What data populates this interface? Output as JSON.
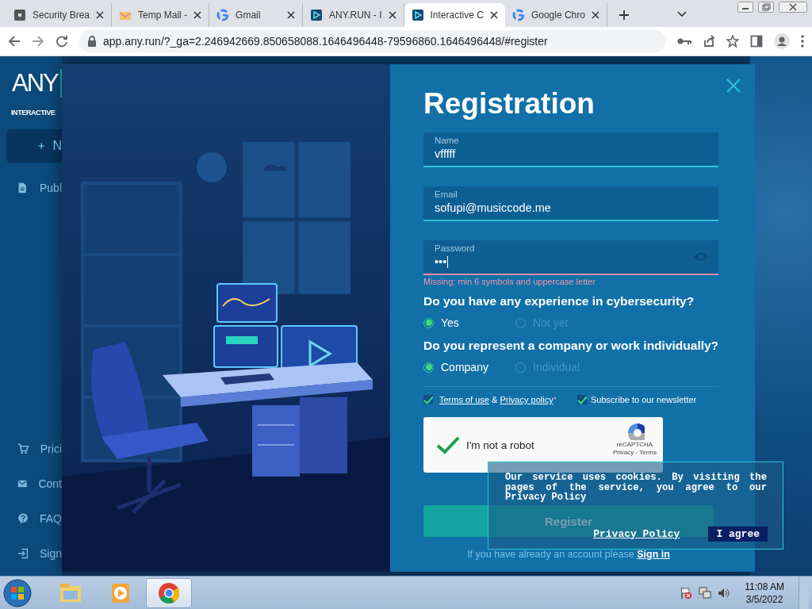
{
  "browser": {
    "tabs": [
      {
        "title": "Security Brea",
        "kind": "square",
        "selected": false
      },
      {
        "title": "Temp Mail -",
        "kind": "mail",
        "selected": false
      },
      {
        "title": "Gmail",
        "kind": "google",
        "selected": false
      },
      {
        "title": "ANY.RUN - I",
        "kind": "anyrun",
        "selected": false
      },
      {
        "title": "Interactive C",
        "kind": "anyrun",
        "selected": true
      },
      {
        "title": "Google Chro",
        "kind": "google",
        "selected": false
      }
    ],
    "url": "app.any.run/?_ga=2.246942669.850658088.1646496448-79596860.1646496448/#register"
  },
  "sidebar": {
    "logo": "ANY",
    "subtitle": "INTERACTIVE",
    "new_button": "N",
    "top_items": [
      {
        "label": "Publ",
        "kind": "document"
      }
    ],
    "bottom_items": [
      {
        "label": "Prici",
        "kind": "cart"
      },
      {
        "label": "Cont",
        "kind": "mail"
      },
      {
        "label": "FAQ",
        "kind": "help"
      },
      {
        "label": "Sign",
        "kind": "signin"
      }
    ]
  },
  "form": {
    "title": "Registration",
    "fields": [
      {
        "label": "Name",
        "value": "vfffff",
        "kind": "text",
        "error": false
      },
      {
        "label": "Email",
        "value": "sofupi@musiccode.me",
        "kind": "text",
        "error": false
      },
      {
        "label": "Password",
        "value": "•••",
        "kind": "password",
        "error": true
      }
    ],
    "error_message": "Missing: min 6 symbols and uppercase letter",
    "questions": [
      {
        "text": "Do you have any experience in cybersecurity?",
        "options": [
          {
            "label": "Yes",
            "selected": true
          },
          {
            "label": "Not yet",
            "selected": false
          }
        ]
      },
      {
        "text": "Do you represent a company or work individually?",
        "options": [
          {
            "label": "Company",
            "selected": true
          },
          {
            "label": "Individual",
            "selected": false
          }
        ]
      }
    ],
    "terms": {
      "checked": true,
      "terms_link": "Terms of use",
      "joiner": "&",
      "privacy_link": "Privacy policy",
      "mark": "*"
    },
    "newsletter": {
      "checked": true,
      "label": "Subscribe to our newsletter"
    },
    "captcha": {
      "checked": true,
      "label": "I'm not a robot",
      "brand": "reCAPTCHA",
      "links": "Privacy - Terms"
    },
    "submit": "Register",
    "signin": {
      "text": "If you have already an account please",
      "link": "Sign in"
    }
  },
  "cookie_banner": {
    "text": "Our service uses cookies. By visiting the pages of the service, you agree to our Privacy Policy",
    "link": "Privacy Policy",
    "button": "I agree"
  },
  "taskbar": {
    "apps": [
      {
        "kind": "explorer",
        "active": false
      },
      {
        "kind": "media",
        "active": false
      },
      {
        "kind": "chrome",
        "active": true
      }
    ],
    "time": "11:08 AM",
    "date": "3/5/2022"
  }
}
